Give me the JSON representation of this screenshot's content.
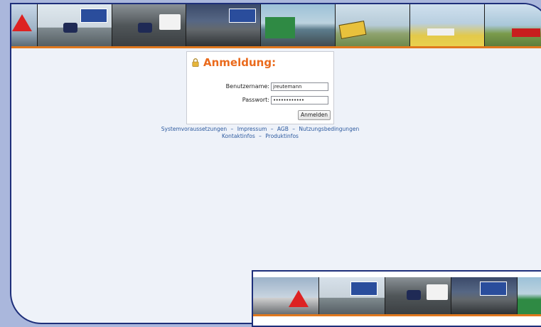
{
  "login": {
    "title": "Anmeldung:",
    "username_label": "Benutzername:",
    "username_value": "jreutemann",
    "password_label": "Passwort:",
    "password_value": "••••••••••••",
    "submit_label": "Anmelden"
  },
  "footer_links": {
    "systemvoraussetzungen": "Systemvoraussetzungen",
    "impressum": "Impressum",
    "agb": "AGB",
    "nutzungsbedingungen": "Nutzungsbedingungen",
    "kontaktinfos": "Kontaktinfos",
    "produktinfos": "Produktinfos",
    "separator": "–"
  },
  "colors": {
    "accent_orange": "#ea6a1c",
    "frame_blue": "#1e2f7a",
    "link_blue": "#2d5a9f"
  },
  "icons": {
    "lock": "lock-icon"
  }
}
